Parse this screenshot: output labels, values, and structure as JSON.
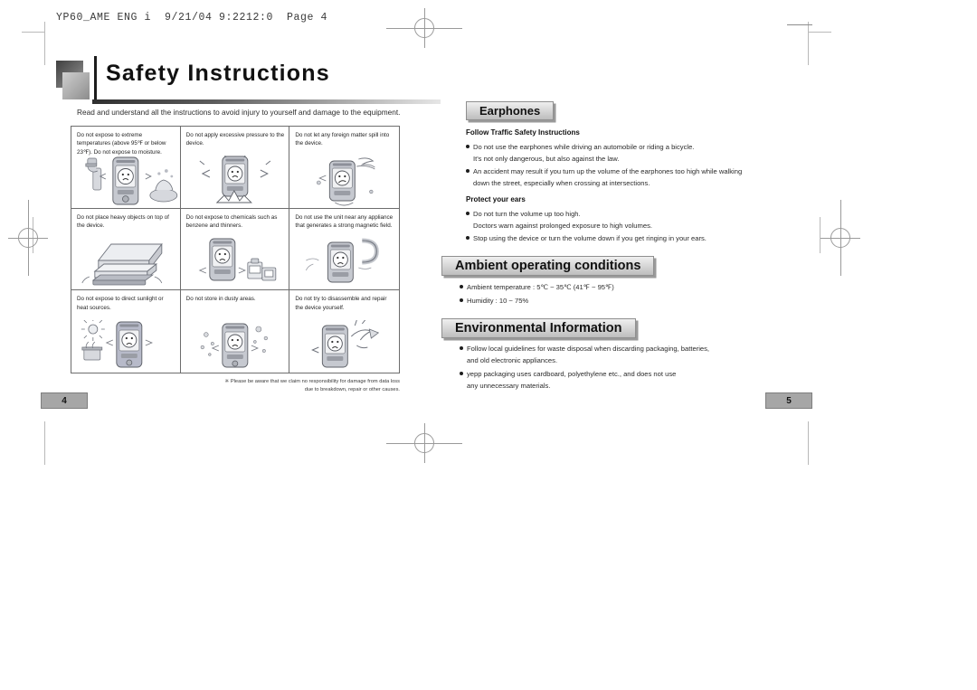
{
  "slug": {
    "text": "YP60_AME ENG i  9/21/04 9:2212:0  Page 4"
  },
  "left_page": {
    "title": "Safety Instructions",
    "lead": "Read and understand all the instructions to avoid injury to yourself and damage to the equipment.",
    "cells": [
      {
        "text": "Do not expose to extreme temperatures (above 95℉ or below 23℉). Do not expose to moisture.",
        "art": "device-heat-moisture-icon"
      },
      {
        "text": "Do not apply excessive pressure to the device.",
        "art": "device-pressure-icon"
      },
      {
        "text": "Do not let any foreign matter spill into the device.",
        "art": "device-spill-icon"
      },
      {
        "text": "Do not place heavy objects on top of the device.",
        "art": "device-heavy-object-icon"
      },
      {
        "text": "Do not expose to chemicals such as benzene and thinners.",
        "art": "device-chemicals-icon"
      },
      {
        "text": "Do not use the unit near any appliance that generates a strong magnetic field.",
        "art": "device-magnet-icon"
      },
      {
        "text": "Do not expose to direct sunlight or heat sources.",
        "art": "device-sunlight-icon"
      },
      {
        "text": "Do not store in dusty areas.",
        "art": "device-dust-icon"
      },
      {
        "text": "Do not try to disassemble and repair the device yourself.",
        "art": "device-disassemble-icon"
      }
    ],
    "footnote_line1": "※ Please be aware that we claim no responsibility for damage from data loss",
    "footnote_line2": "due to breakdown, repair or other causes.",
    "page_number": "4"
  },
  "right_page": {
    "earphones": {
      "heading": "Earphones",
      "subhead_traffic": "Follow Traffic Safety Instructions",
      "b1_line1": "Do not use the earphones while driving an automobile or riding a bicycle.",
      "b1_line2": "It's not only dangerous, but also against the law.",
      "b2_line1": "An accident may result if you turn up the volume of the earphones too high while walking",
      "b2_line2": "down the street, especially when crossing at intersections.",
      "subhead_ears": "Protect your ears",
      "b3_line1": "Do not turn the volume up too high.",
      "b3_line2": "Doctors warn against prolonged exposure to high volumes.",
      "b4_line1": "Stop using the device or turn the volume down if you get ringing in your ears."
    },
    "ambient": {
      "heading": "Ambient operating conditions",
      "b1": "Ambient temperature : 5℃ ~ 35℃ (41℉ ~ 95℉)",
      "b2": "Humidity : 10 ~ 75%"
    },
    "environmental": {
      "heading": "Environmental Information",
      "b1_line1": "Follow local guidelines for waste disposal when discarding packaging, batteries,",
      "b1_line2": "and old electronic appliances.",
      "b2_line1": "yepp packaging uses cardboard, polyethylene etc., and does not use",
      "b2_line2": "any unnecessary materials."
    },
    "page_number": "5"
  }
}
